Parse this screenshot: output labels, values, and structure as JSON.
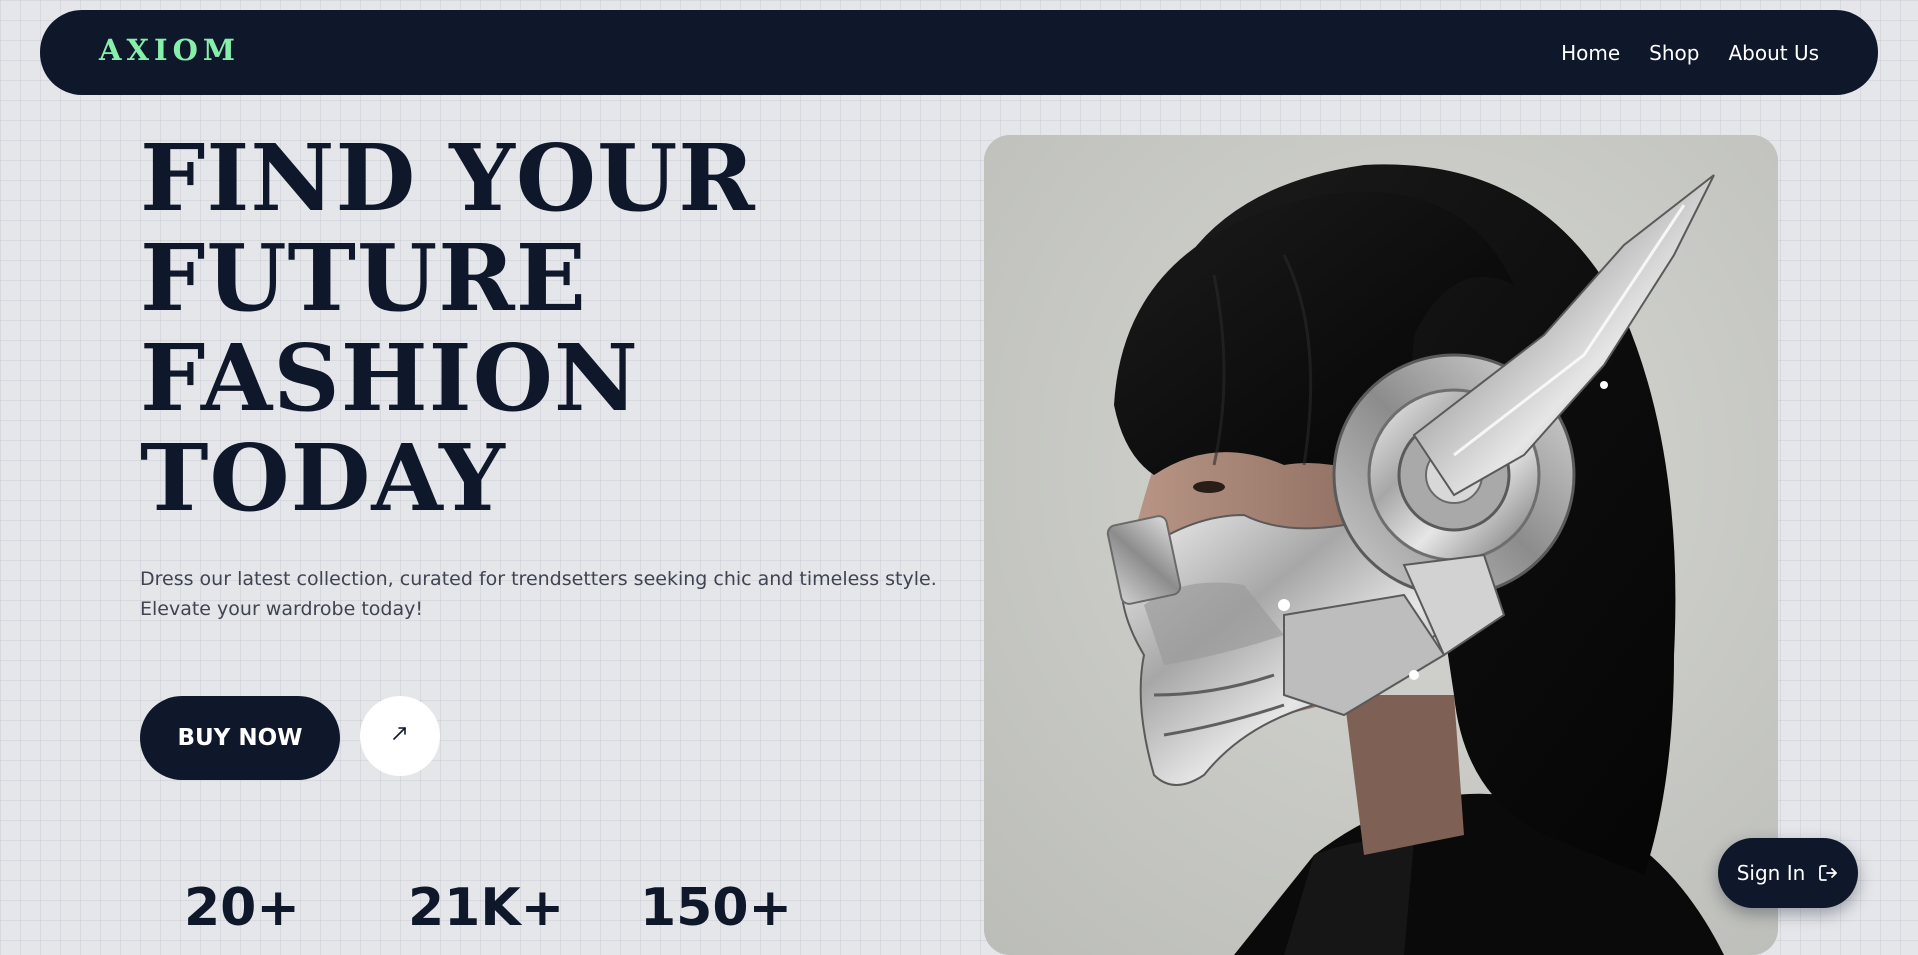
{
  "header": {
    "logo": "AXIOM",
    "nav": [
      {
        "label": "Home"
      },
      {
        "label": "Shop"
      },
      {
        "label": "About Us"
      }
    ]
  },
  "hero": {
    "title_lines": [
      "FIND YOUR",
      "FUTURE",
      "FASHION",
      "TODAY"
    ],
    "description_lines": [
      "Dress our latest collection, curated for trendsetters seeking chic and timeless style.",
      "Elevate your wardrobe today!"
    ],
    "buy_label": "BUY NOW",
    "arrow_icon": "arrow-up-right-icon",
    "stats": [
      {
        "value": "20+"
      },
      {
        "value": "21K+"
      },
      {
        "value": "150+"
      }
    ],
    "image_icon": "model-with-cyber-mask-photo"
  },
  "signin": {
    "label": "Sign In",
    "icon": "sign-in-icon"
  },
  "colors": {
    "navy": "#0f172a",
    "accent_mint": "#86efac",
    "background": "#e5e6ea",
    "white": "#ffffff"
  }
}
